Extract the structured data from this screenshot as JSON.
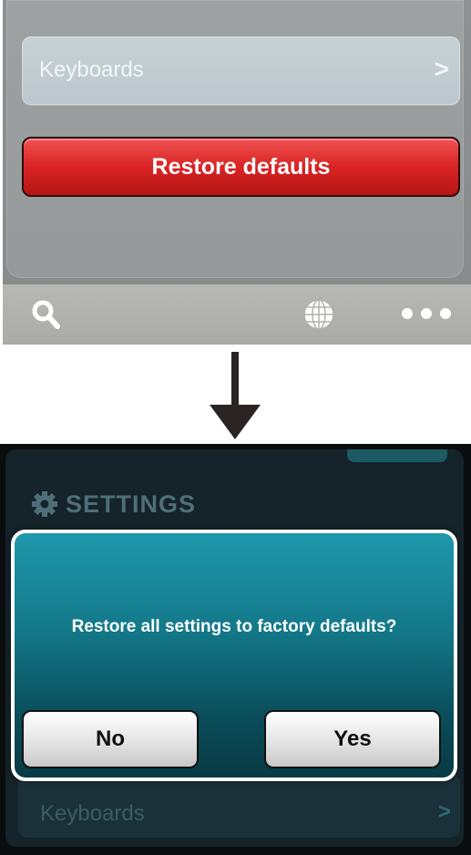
{
  "top": {
    "keyboards_label": "Keyboards",
    "chevron": ">",
    "restore_label": "Restore defaults",
    "icons": [
      "search-icon",
      "globe-icon",
      "more-icon"
    ]
  },
  "settings": {
    "title": "SETTINGS",
    "keyboards_label": "Keyboards",
    "chevron": ">"
  },
  "dialog": {
    "message": "Restore all settings to factory defaults?",
    "no_label": "No",
    "yes_label": "Yes"
  },
  "colors": {
    "restore_red": "#d92424",
    "dialog_teal": "#137889",
    "arrow": "#2b2424"
  }
}
